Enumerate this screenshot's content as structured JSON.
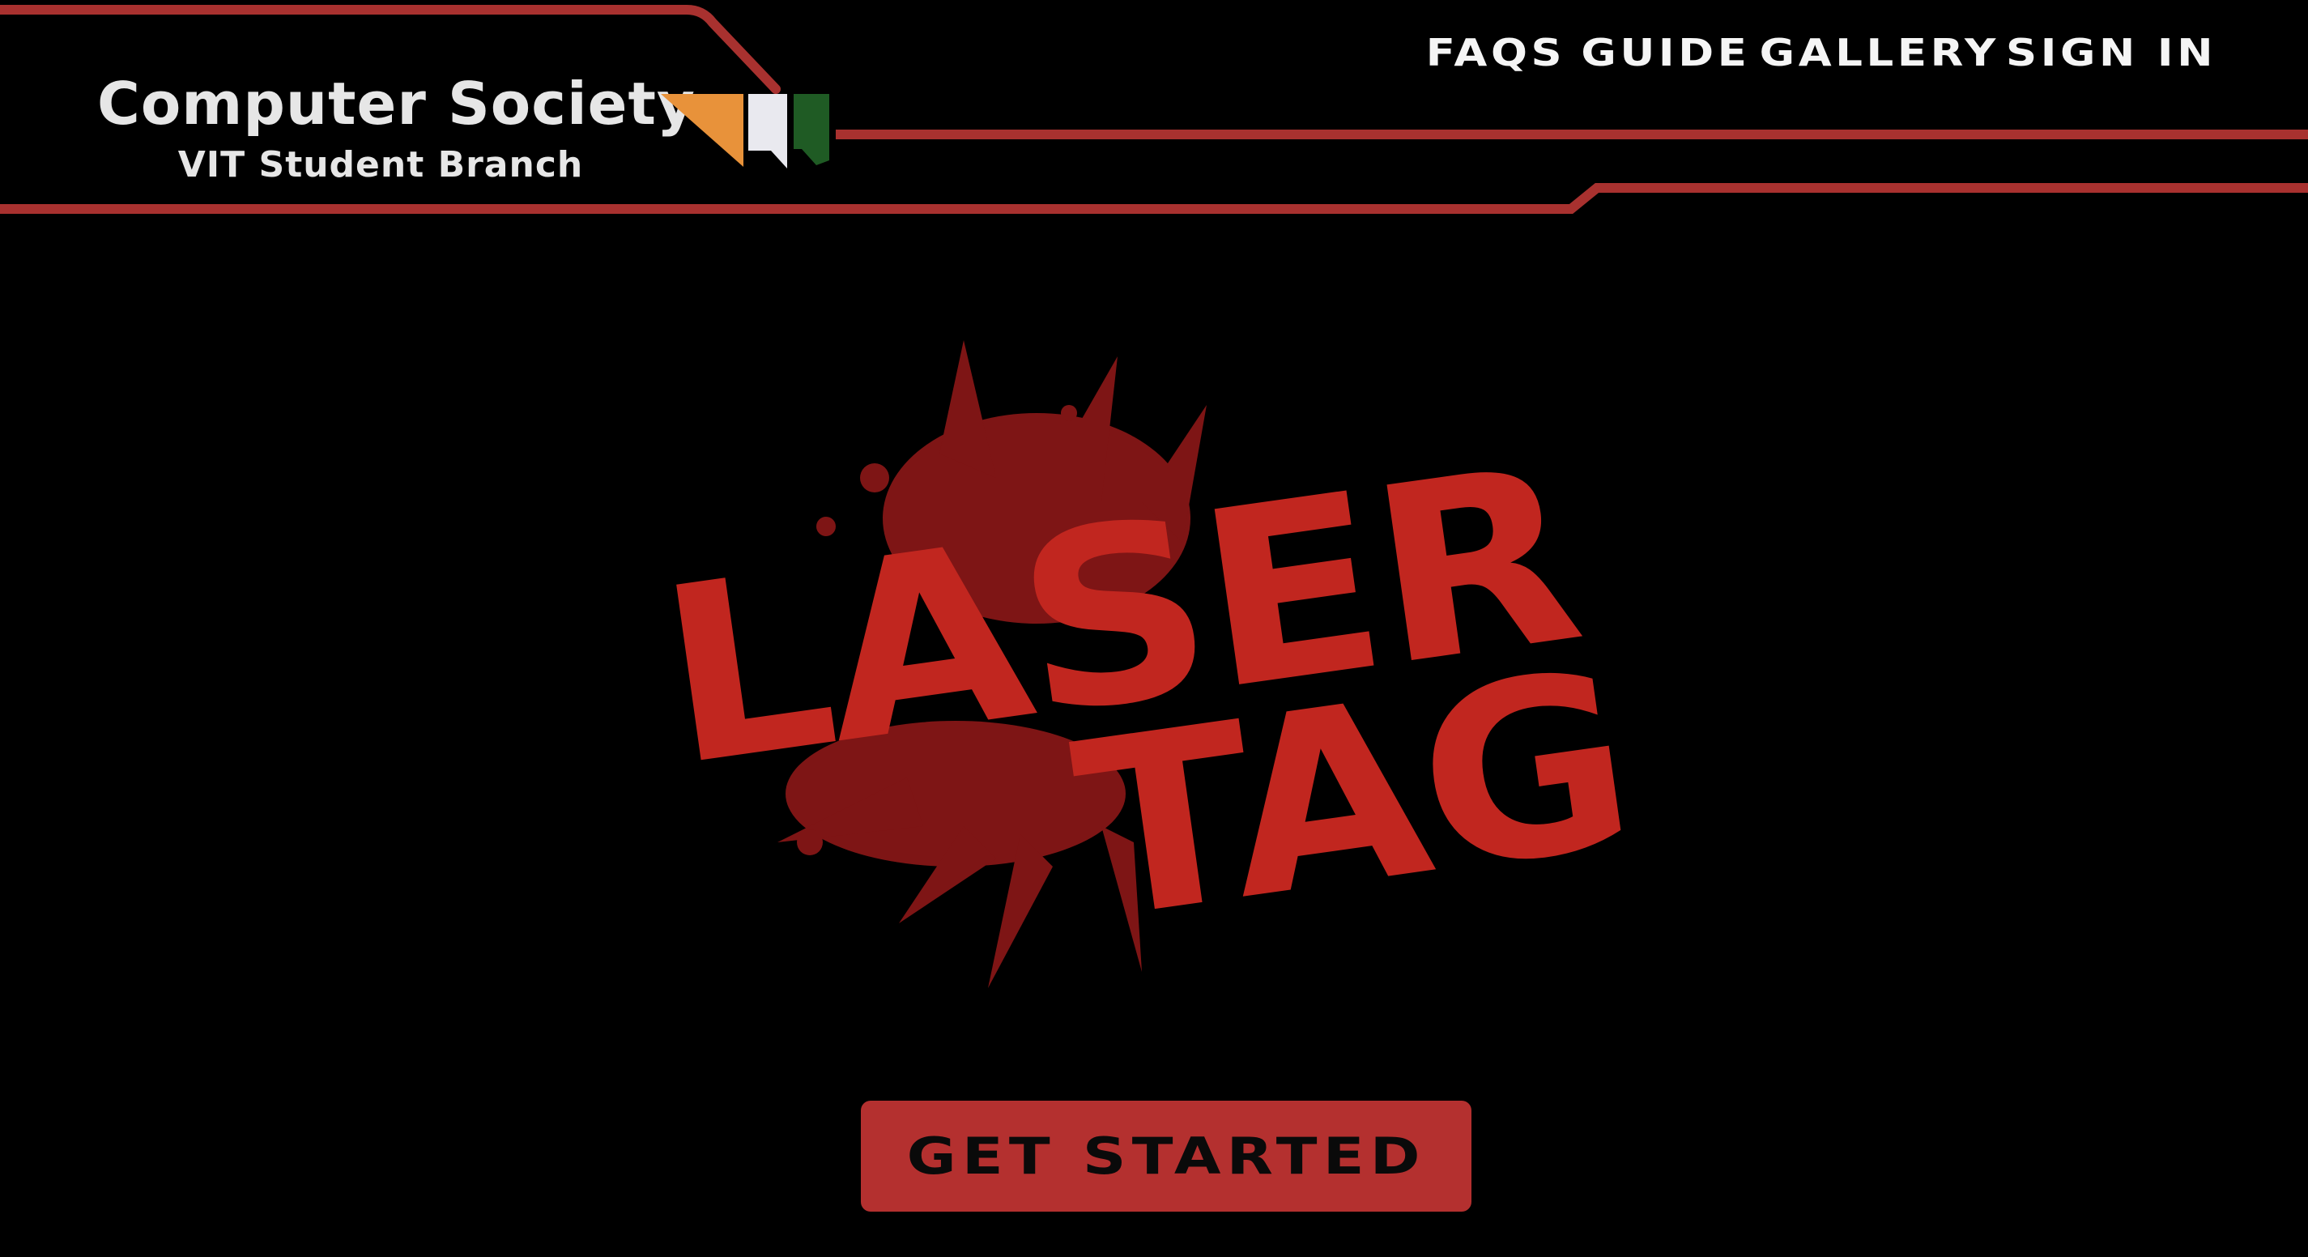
{
  "brand": {
    "title": "Computer Society",
    "subtitle": "VIT Student Branch",
    "logo_icon": "tricolor-chevron-icon",
    "logo_colors": [
      "#e8923a",
      "#e9e9ef",
      "#1f5b24"
    ]
  },
  "nav": {
    "items": [
      {
        "label": "FAQS"
      },
      {
        "label": "GUIDE"
      },
      {
        "label": "GALLERY"
      },
      {
        "label": "SIGN IN"
      }
    ]
  },
  "hero": {
    "logo_line1": "LASER",
    "logo_line2": "TAG",
    "logo_color": "#c1261f",
    "splatter_color": "#7e1515"
  },
  "cta": {
    "label": "GET STARTED",
    "color": "#b4302f"
  },
  "theme": {
    "background": "#000000",
    "accent": "#a8312f",
    "text": "#f5f5f5"
  }
}
